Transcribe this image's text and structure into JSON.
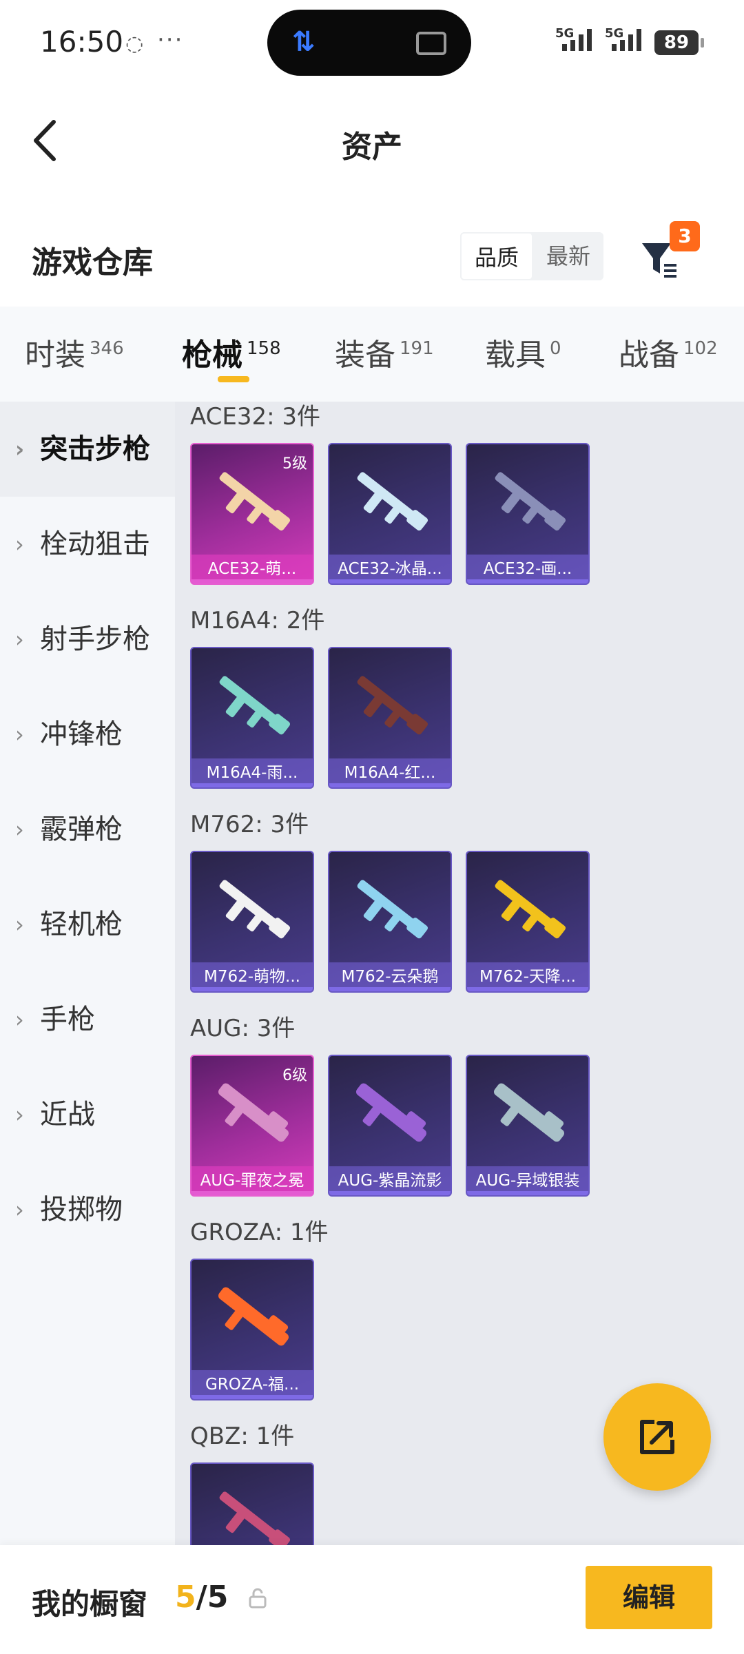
{
  "status_bar": {
    "time": "16:50",
    "network_1": "5G",
    "network_2": "5G",
    "battery": "89"
  },
  "nav": {
    "title": "资产"
  },
  "section": {
    "title": "游戏仓库",
    "sort_quality": "品质",
    "sort_latest": "最新",
    "filter_badge": "3"
  },
  "tabs": [
    {
      "label": "时装",
      "count": "346"
    },
    {
      "label": "枪械",
      "count": "158"
    },
    {
      "label": "装备",
      "count": "191"
    },
    {
      "label": "载具",
      "count": "0"
    },
    {
      "label": "战备",
      "count": "102"
    }
  ],
  "categories": [
    "突击步枪",
    "栓动狙击",
    "射手步枪",
    "冲锋枪",
    "霰弹枪",
    "轻机枪",
    "手枪",
    "近战",
    "投掷物"
  ],
  "groups": [
    {
      "label": "ACE32: 3件",
      "items": [
        {
          "name": "ACE32-萌...",
          "level": "5级",
          "rarity": "pink"
        },
        {
          "name": "ACE32-冰晶...",
          "level": "",
          "rarity": "purple"
        },
        {
          "name": "ACE32-画...",
          "level": "",
          "rarity": "purple"
        }
      ]
    },
    {
      "label": "M16A4: 2件",
      "items": [
        {
          "name": "M16A4-雨...",
          "level": "",
          "rarity": "purple"
        },
        {
          "name": "M16A4-红...",
          "level": "",
          "rarity": "purple"
        }
      ]
    },
    {
      "label": "M762: 3件",
      "items": [
        {
          "name": "M762-萌物...",
          "level": "",
          "rarity": "purple"
        },
        {
          "name": "M762-云朵鹅",
          "level": "",
          "rarity": "purple"
        },
        {
          "name": "M762-天降...",
          "level": "",
          "rarity": "purple"
        }
      ]
    },
    {
      "label": "AUG: 3件",
      "items": [
        {
          "name": "AUG-罪夜之冕",
          "level": "6级",
          "rarity": "pink"
        },
        {
          "name": "AUG-紫晶流影",
          "level": "",
          "rarity": "purple"
        },
        {
          "name": "AUG-异域银装",
          "level": "",
          "rarity": "purple"
        }
      ]
    },
    {
      "label": "GROZA: 1件",
      "items": [
        {
          "name": "GROZA-福...",
          "level": "",
          "rarity": "purple"
        }
      ]
    },
    {
      "label": "QBZ: 1件",
      "items": [
        {
          "name": "",
          "level": "",
          "rarity": "purple"
        }
      ]
    }
  ],
  "gun_colors": [
    "#f3d4a8",
    "#cfe8f5",
    "#8a8fb8",
    "#7fd6c9",
    "#7a3a34",
    "#f2f2f2",
    "#8fd3ef",
    "#f2c21c",
    "#d88fc8",
    "#9a62d6",
    "#a8c0c8",
    "#ff6a2a",
    "#c84f7a"
  ],
  "bottom": {
    "label": "我的橱窗",
    "current": "5",
    "total": "/5",
    "edit": "编辑"
  }
}
